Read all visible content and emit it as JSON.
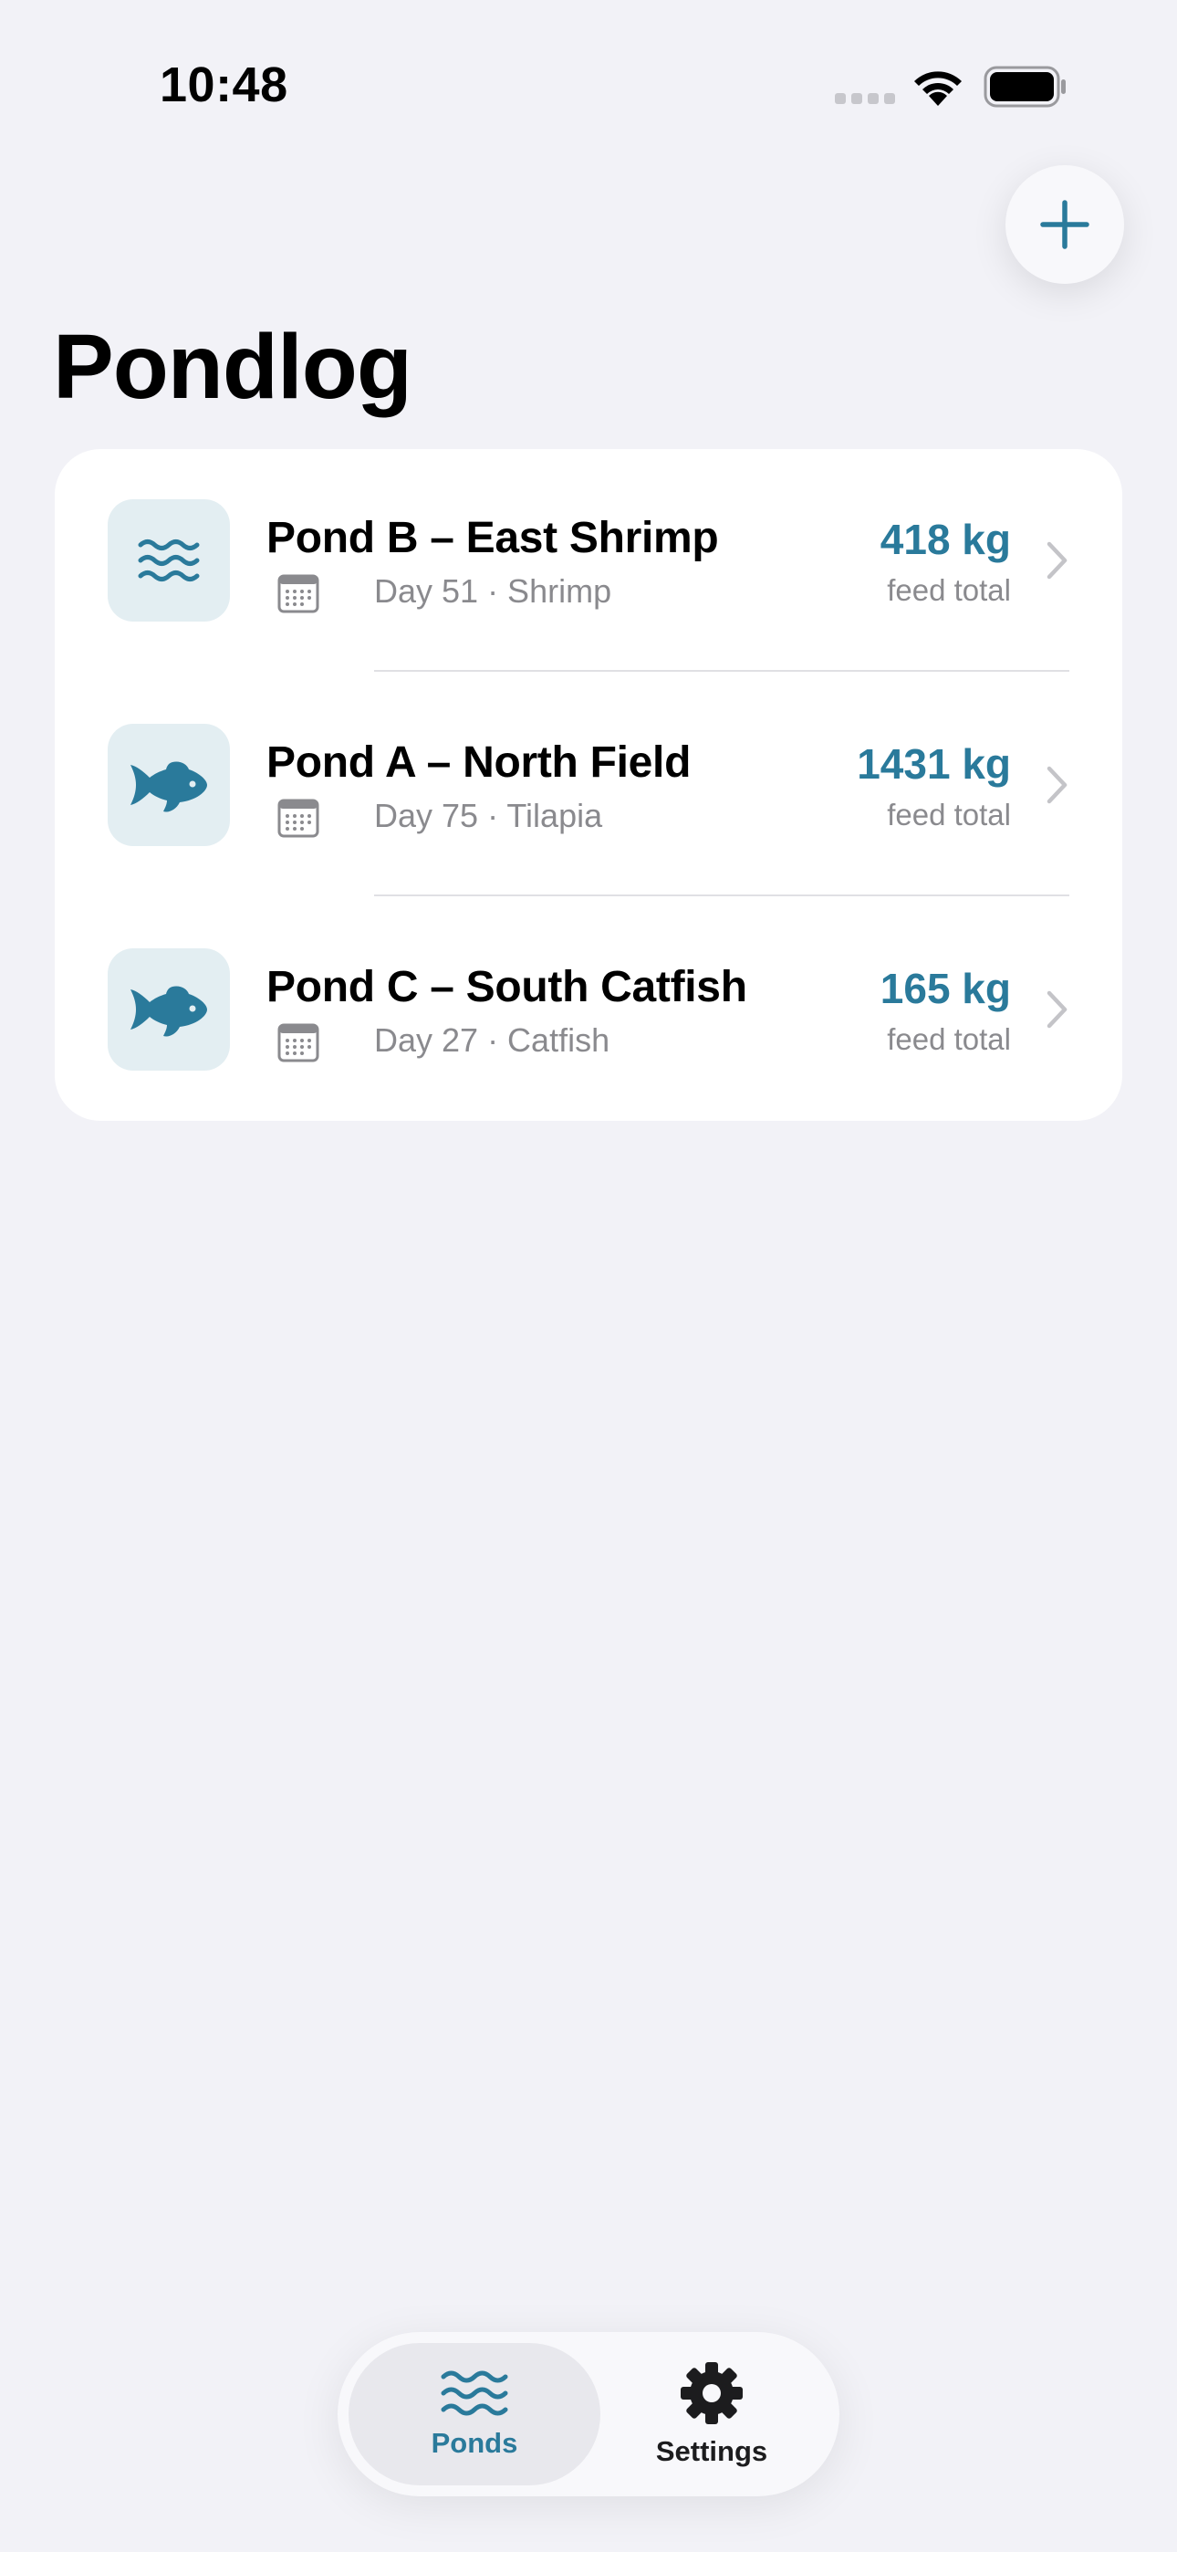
{
  "status_bar": {
    "time": "10:48"
  },
  "header": {
    "title": "Pondlog",
    "add_icon": "plus-icon"
  },
  "ponds": [
    {
      "name": "Pond B – East Shrimp",
      "subtitle": "Day 51 · Shrimp",
      "amount": "418 kg",
      "amount_label": "feed total",
      "icon": "waves-icon"
    },
    {
      "name": "Pond A – North Field",
      "subtitle": "Day 75 · Tilapia",
      "amount": "1431 kg",
      "amount_label": "feed total",
      "icon": "fish-icon"
    },
    {
      "name": "Pond C – South Catfish",
      "subtitle": "Day 27 · Catfish",
      "amount": "165 kg",
      "amount_label": "feed total",
      "icon": "fish-icon"
    }
  ],
  "tabs": [
    {
      "label": "Ponds",
      "icon": "waves-icon",
      "active": true
    },
    {
      "label": "Settings",
      "icon": "gear-icon",
      "active": false
    }
  ],
  "colors": {
    "accent": "#2A7A9B",
    "background": "#F2F2F7",
    "tile": "#E3EEF2"
  }
}
